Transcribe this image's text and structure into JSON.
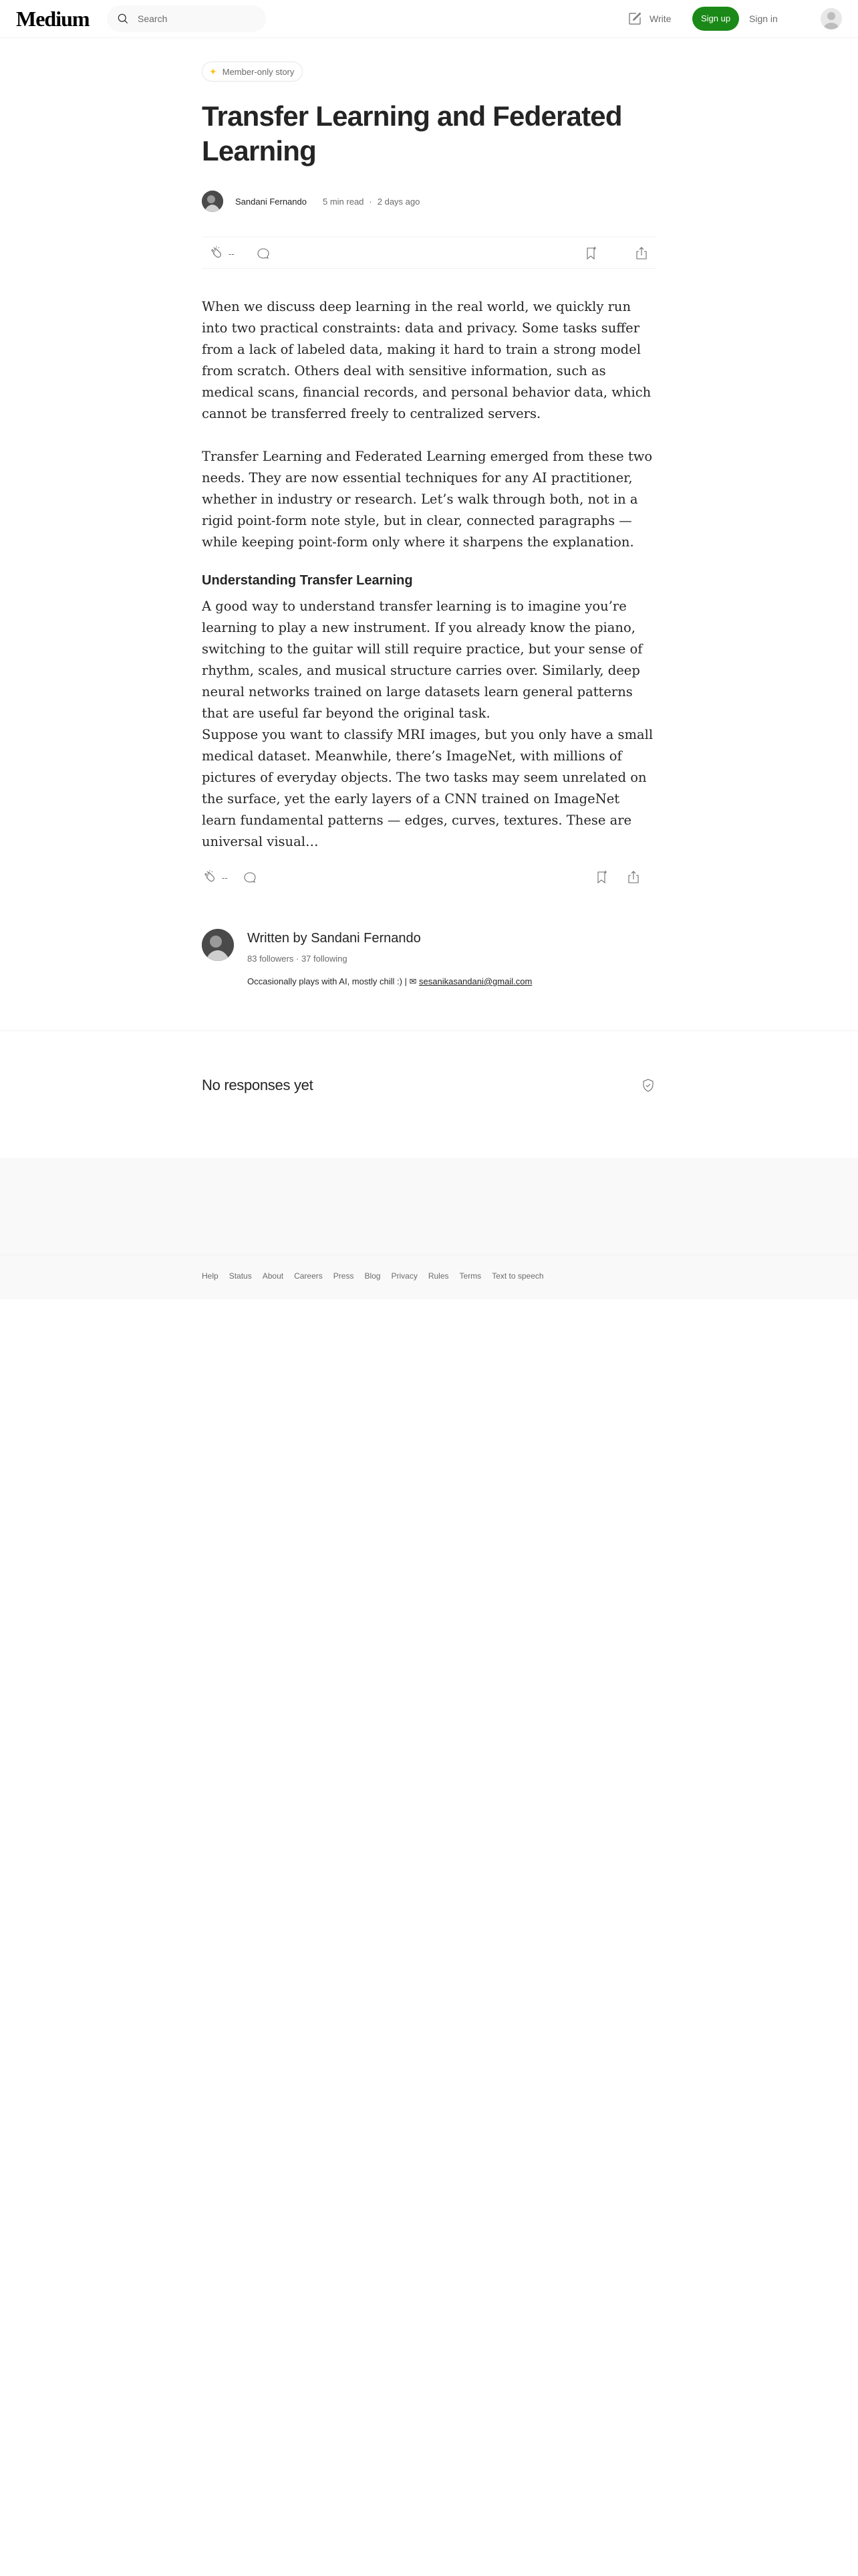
{
  "header": {
    "logo": "Medium",
    "search_placeholder": "Search",
    "write_label": "Write",
    "signup_label": "Sign up",
    "signin_label": "Sign in"
  },
  "article": {
    "member_label": "Member-only story",
    "title": "Transfer Learning and Federated Learning",
    "author": "Sandani Fernando",
    "read_time": "5 min read",
    "published": "2 days ago",
    "clap_count": "--",
    "paragraphs": [
      "When we discuss deep learning in the real world, we quickly run into two practical constraints: data and privacy. Some tasks suffer from a lack of labeled data, making it hard to train a strong model from scratch. Others deal with sensitive information, such as medical scans, financial records, and personal behavior data, which cannot be transferred freely to centralized servers.",
      "Transfer Learning and Federated Learning emerged from these two needs. They are now essential techniques for any AI practitioner, whether in industry or research. Let’s walk through both, not in a rigid point-form note style, but in clear, connected paragraphs — while keeping point-form only where it sharpens the explanation.",
      "A good way to understand transfer learning is to imagine you’re learning to play a new instrument. If you already know the piano, switching to the guitar will still require practice, but your sense of rhythm, scales, and musical structure carries over. Similarly, deep neural networks trained on large datasets learn general patterns that are useful far beyond the original task.",
      "Suppose you want to classify MRI images, but you only have a small medical dataset. Meanwhile, there’s ImageNet, with millions of pictures of everyday objects. The two tasks may seem unrelated on the surface, yet the early layers of a CNN trained on ImageNet learn fundamental patterns — edges, curves, textures. These are universal visual…"
    ],
    "section_heading": "Understanding Transfer Learning"
  },
  "author_block": {
    "written_by": "Written by Sandani Fernando",
    "followers": "83 followers",
    "following": "37 following",
    "bio_text": "Occasionally plays with AI, mostly chill :) | ✉ ",
    "email": "sesanikasandani@gmail.com"
  },
  "responses": {
    "heading": "No responses yet"
  },
  "footer": {
    "links": [
      "Help",
      "Status",
      "About",
      "Careers",
      "Press",
      "Blog",
      "Privacy",
      "Rules",
      "Terms",
      "Text to speech"
    ]
  },
  "colors": {
    "accent_green": "#1a8917",
    "star": "#ffc017",
    "muted": "#6b6b6b",
    "text": "#242424"
  },
  "icons": [
    "search-icon",
    "write-icon",
    "user-avatar-icon",
    "star-icon",
    "clap-icon",
    "comment-icon",
    "bookmark-icon",
    "share-icon",
    "shield-icon"
  ]
}
